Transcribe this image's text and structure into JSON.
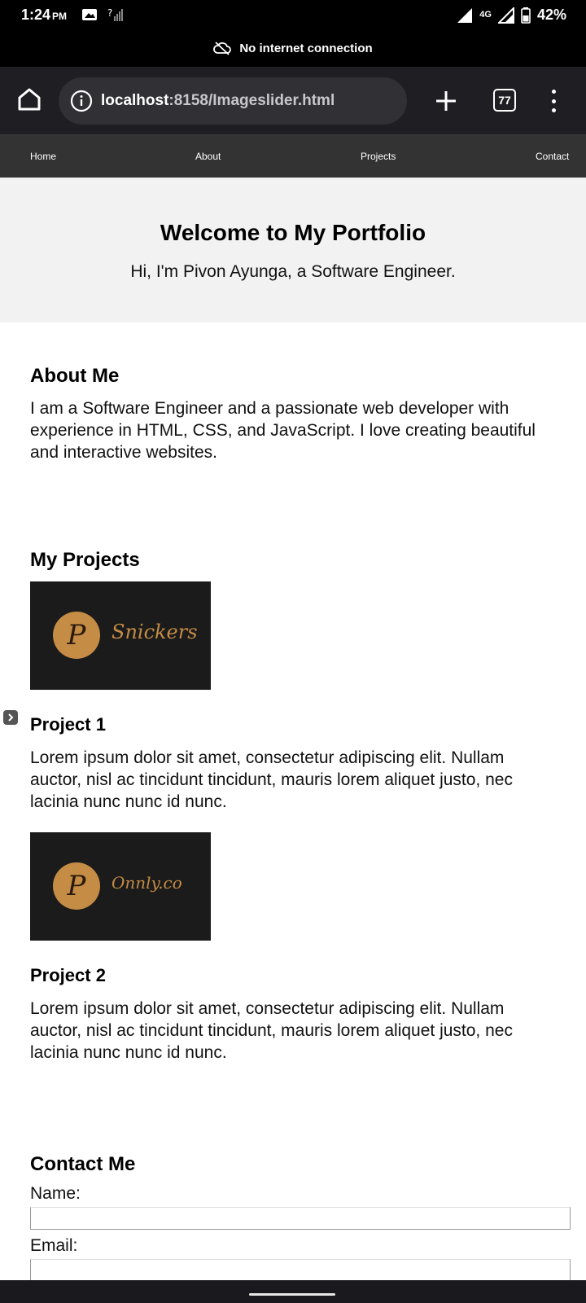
{
  "status_bar": {
    "time": "1:24",
    "ampm": "PM",
    "network": "4G",
    "battery": "42%"
  },
  "banner": {
    "text": "No internet connection"
  },
  "browser": {
    "url_host": "localhost",
    "url_rest": ":8158/Imageslider.html",
    "tab_count": "77"
  },
  "nav": {
    "items": [
      "Home",
      "About",
      "Projects",
      "Contact"
    ]
  },
  "hero": {
    "title": "Welcome to My Portfolio",
    "subtitle": "Hi, I'm Pivon Ayunga, a Software Engineer."
  },
  "about": {
    "heading": "About Me",
    "text": "I am a Software Engineer and a passionate web developer with experience in HTML, CSS, and JavaScript. I love creating beautiful and interactive websites."
  },
  "projects": {
    "heading": "My Projects",
    "items": [
      {
        "title": "Project 1",
        "logo_letter": "P",
        "logo_word": "Snickers",
        "text": "Lorem ipsum dolor sit amet, consectetur adipiscing elit. Nullam auctor, nisl ac tincidunt tincidunt, mauris lorem aliquet justo, nec lacinia nunc nunc id nunc."
      },
      {
        "title": "Project 2",
        "logo_letter": "P",
        "logo_word": "Onnly.co",
        "text": "Lorem ipsum dolor sit amet, consectetur adipiscing elit. Nullam auctor, nisl ac tincidunt tincidunt, mauris lorem aliquet justo, nec lacinia nunc nunc id nunc."
      }
    ]
  },
  "contact": {
    "heading": "Contact Me",
    "name_label": "Name:",
    "email_label": "Email:",
    "name_value": "",
    "email_value": ""
  },
  "colors": {
    "nav_bg": "#333333",
    "hero_bg": "#f2f2f2",
    "logo_gold": "#c48c45",
    "browser_bg": "#1f1f23"
  }
}
